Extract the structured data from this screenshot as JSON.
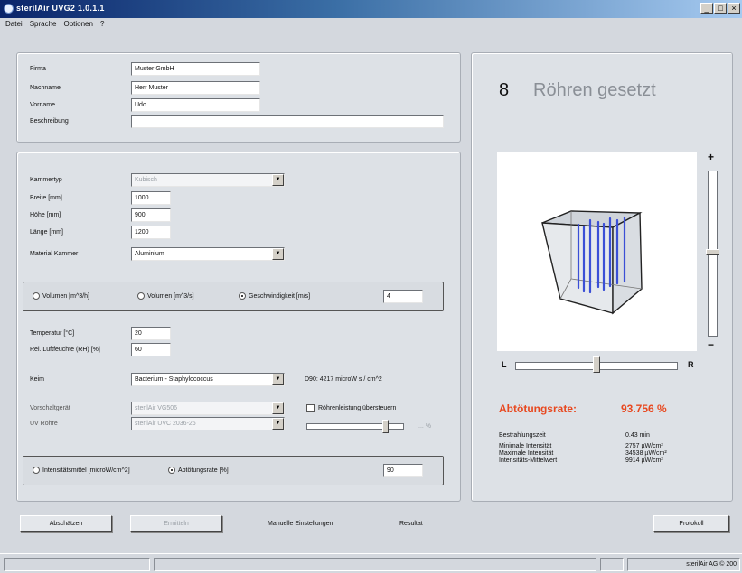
{
  "window": {
    "title": "sterilAir UVG2  1.0.1.1",
    "controls": [
      "_",
      "□",
      "×"
    ]
  },
  "menu": [
    "Datei",
    "Sprache",
    "Optionen",
    "?"
  ],
  "customer": {
    "firma_label": "Firma",
    "firma_value": "Muster GmbH",
    "nachname_label": "Nachname",
    "nachname_value": "Herr Muster",
    "vorname_label": "Vorname",
    "vorname_value": "Udo",
    "beschreibung_label": "Beschreibung",
    "beschreibung_value": ""
  },
  "room": {
    "kammertyp_label": "Kammertyp",
    "kammertyp_value": "Kubisch",
    "breite_label": "Breite [mm]",
    "breite_value": "1000",
    "hoehe_label": "Höhe [mm]",
    "hoehe_value": "900",
    "laenge_label": "Länge [mm]",
    "laenge_value": "1200",
    "material_label": "Material Kammer",
    "material_value": "Aluminium"
  },
  "flow": {
    "option1": "Volumen [m^3/h]",
    "option2": "Volumen [m^3/s]",
    "option3": "Geschwindigkeit [m/s]",
    "selected": 3,
    "value": "4"
  },
  "climate": {
    "temp_label": "Temperatur [°C]",
    "temp_value": "20",
    "humidity_label": "Rel. Luftfeuchte (RH) [%]",
    "humidity_value": "60"
  },
  "germ": {
    "label": "Keim",
    "value": "Bacterium - Staphylococcus",
    "d90_text": "D90: 4217 microW s / cm^2"
  },
  "device": {
    "vorschalt_label": "Vorschaltgerät",
    "vorschalt_value": "sterilAir VG506",
    "uvroehre_label": "UV Röhre",
    "uvroehre_value": "sterilAir UVC 2036-26",
    "check_label": "Röhrenleistung übersteuern",
    "slider_value_text": "... %"
  },
  "target": {
    "option1": "Intensitätsmittel [microW/cm^2]",
    "option2": "Abtötungsrate [%]",
    "selected": 2,
    "value": "90"
  },
  "result": {
    "count": "8",
    "count_label": "Röhren gesetzt",
    "plus": "+",
    "minus": "−",
    "left_label": "L",
    "right_label": "R",
    "rate_label": "Abtötungsrate:",
    "rate_value": "93.756  %",
    "stats": [
      {
        "label": "Bestrahlungszeit",
        "value": "0.43  min"
      },
      {
        "label": "Minimale Intensität",
        "value": "2757  µW/cm²"
      },
      {
        "label": "Maximale Intensität",
        "value": "34538  µW/cm²"
      },
      {
        "label": "Intensitäts-Mittelwert",
        "value": "9914  µW/cm²"
      }
    ],
    "accent_color": "#e8481f",
    "tube_color": "#3b4fd6",
    "slider_vertical_level": 0.5,
    "slider_horizontal_level": 0.5
  },
  "footer": {
    "abschaetzen": "Abschätzen",
    "ermitteln": "Ermitteln",
    "manuell": "Manuelle Einstellungen",
    "resultat": "Resultat",
    "protokoll": "Protokoll"
  },
  "status": {
    "copyright": "sterilAir AG  © 200"
  }
}
